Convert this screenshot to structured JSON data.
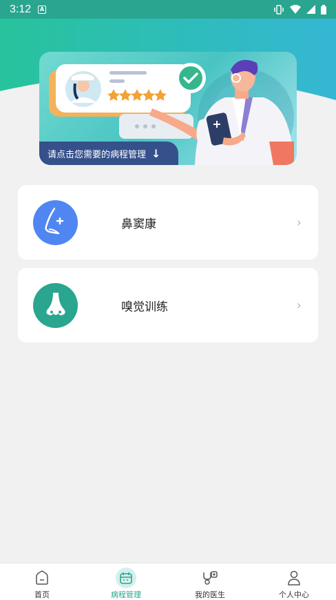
{
  "status_bar": {
    "time": "3:12",
    "notification_icon": "a-box-icon",
    "icons": [
      "vibrate-icon",
      "wifi-icon",
      "signal-icon",
      "battery-icon"
    ]
  },
  "banner": {
    "caption": "请点击您需要的病程管理",
    "arrow": "↓",
    "stars": 5
  },
  "cards": [
    {
      "label": "鼻窦康",
      "icon": "nose-profile-icon",
      "color": "#4f86f2",
      "chevron": "›"
    },
    {
      "label": "嗅觉训练",
      "icon": "nose-icon",
      "color": "#2aa58f",
      "chevron": "›"
    }
  ],
  "tabs": [
    {
      "label": "首页",
      "icon": "home-icon",
      "active": false
    },
    {
      "label": "病程管理",
      "icon": "calendar-icon",
      "active": true
    },
    {
      "label": "我的医生",
      "icon": "doctor-icon",
      "active": false
    },
    {
      "label": "个人中心",
      "icon": "person-icon",
      "active": false
    }
  ],
  "colors": {
    "accent": "#2aa58f",
    "banner_caption_bg": "#35508a"
  }
}
